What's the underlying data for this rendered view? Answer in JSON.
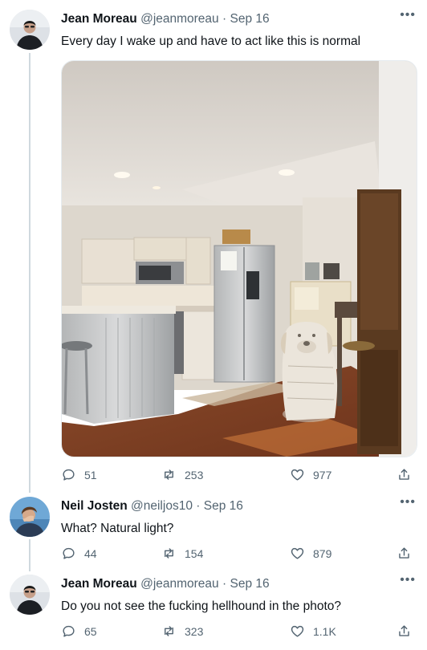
{
  "tweets": [
    {
      "name": "Jean Moreau",
      "handle": "@jeanmoreau",
      "separator": "·",
      "date": "Sep 16",
      "text": "Every day I wake up and have to act like this is normal",
      "replies": "51",
      "retweets": "253",
      "likes": "977"
    },
    {
      "name": "Neil Josten",
      "handle": "@neiljos10",
      "separator": "·",
      "date": "Sep 16",
      "text": "What? Natural light?",
      "replies": "44",
      "retweets": "154",
      "likes": "879"
    },
    {
      "name": "Jean Moreau",
      "handle": "@jeanmoreau",
      "separator": "·",
      "date": "Sep 16",
      "text": "Do you not see the fucking hellhound in the photo?",
      "replies": "65",
      "retweets": "323",
      "likes": "1.1K"
    }
  ],
  "icons": {
    "more": "more-icon",
    "reply": "reply-icon",
    "retweet": "retweet-icon",
    "like": "heart-icon",
    "share": "share-icon"
  },
  "colors": {
    "text": "#0f1419",
    "muted": "#536471",
    "thread_line": "#cfd9de"
  }
}
